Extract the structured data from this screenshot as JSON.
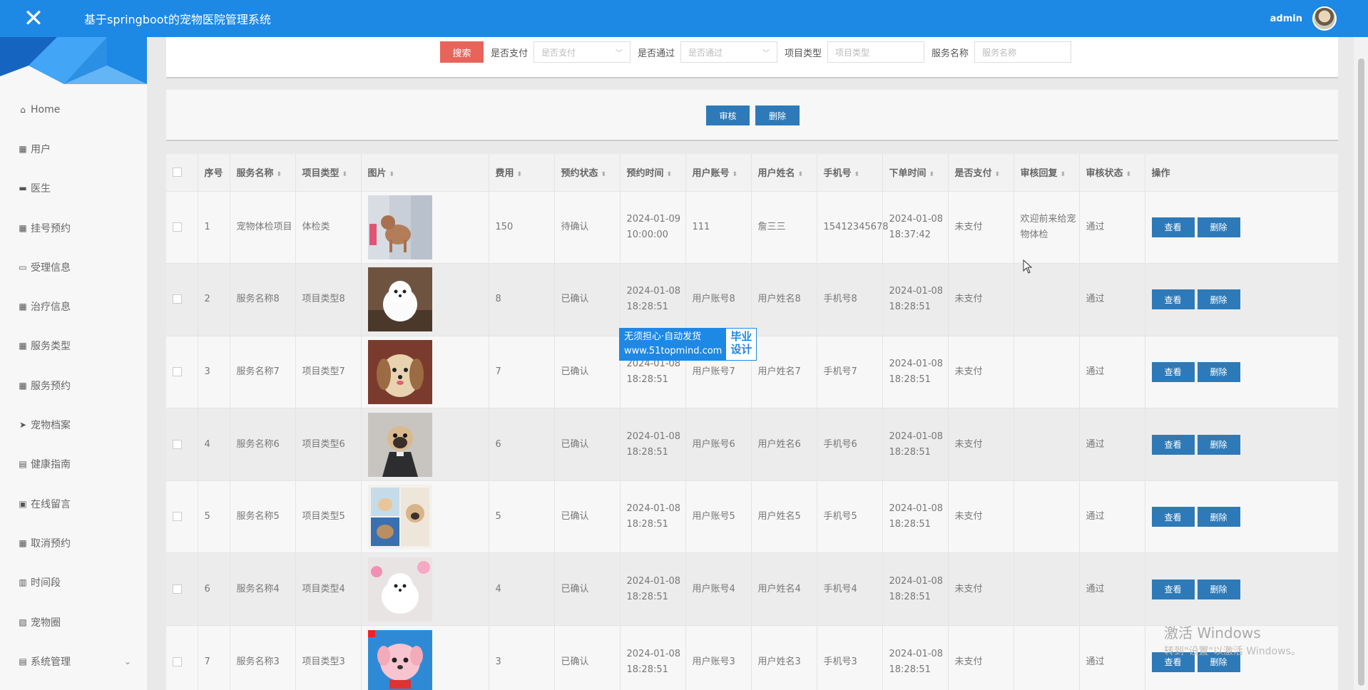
{
  "header": {
    "close_icon": "✕",
    "title": "基于springboot的宠物医院管理系统",
    "username": "admin"
  },
  "sidebar": {
    "items": [
      {
        "icon": "⌂",
        "label": "Home"
      },
      {
        "icon": "▦",
        "label": "用户"
      },
      {
        "icon": "▬",
        "label": "医生"
      },
      {
        "icon": "▦",
        "label": "挂号预约"
      },
      {
        "icon": "▭",
        "label": "受理信息"
      },
      {
        "icon": "▦",
        "label": "治疗信息"
      },
      {
        "icon": "▦",
        "label": "服务类型"
      },
      {
        "icon": "▦",
        "label": "服务预约"
      },
      {
        "icon": "➤",
        "label": "宠物档案"
      },
      {
        "icon": "▤",
        "label": "健康指南"
      },
      {
        "icon": "▣",
        "label": "在线留言"
      },
      {
        "icon": "▦",
        "label": "取消预约"
      },
      {
        "icon": "▥",
        "label": "时间段"
      },
      {
        "icon": "▧",
        "label": "宠物圈"
      },
      {
        "icon": "▤",
        "label": "系统管理",
        "arrow": "⌄"
      }
    ]
  },
  "search": {
    "button": "搜索",
    "paid_label": "是否支付",
    "paid_placeholder": "是否支付",
    "approved_label": "是否通过",
    "approved_placeholder": "是否通过",
    "type_label": "项目类型",
    "type_placeholder": "项目类型",
    "service_label": "服务名称",
    "service_placeholder": "服务名称"
  },
  "actions": {
    "audit": "审核",
    "delete": "删除"
  },
  "table": {
    "headers": [
      "序号",
      "服务名称",
      "项目类型",
      "图片",
      "费用",
      "预约状态",
      "预约时间",
      "用户账号",
      "用户姓名",
      "手机号",
      "下单时间",
      "是否支付",
      "审核回复",
      "审核状态",
      "操作"
    ],
    "sortable": [
      "服务名称",
      "项目类型",
      "图片",
      "费用",
      "预约状态",
      "预约时间",
      "用户账号",
      "用户姓名",
      "手机号",
      "下单时间",
      "是否支付",
      "审核回复",
      "审核状态"
    ],
    "view_label": "查看",
    "delete_label": "删除",
    "rows": [
      {
        "no": "1",
        "service": "宠物体检项目",
        "type": "体检类",
        "img": "poodle",
        "fee": "150",
        "status": "待确认",
        "appt_time": "2024-01-09 10:00:00",
        "account": "111",
        "name": "詹三三",
        "phone": "15412345678",
        "order_time": "2024-01-08 18:37:42",
        "paid": "未支付",
        "reply": "欢迎前来给宠物体检",
        "audit": "通过"
      },
      {
        "no": "2",
        "service": "服务名称8",
        "type": "项目类型8",
        "img": "pomeranian",
        "fee": "8",
        "status": "已确认",
        "appt_time": "2024-01-08 18:28:51",
        "account": "用户账号8",
        "name": "用户姓名8",
        "phone": "手机号8",
        "order_time": "2024-01-08 18:28:51",
        "paid": "未支付",
        "reply": "",
        "audit": "通过"
      },
      {
        "no": "3",
        "service": "服务名称7",
        "type": "项目类型7",
        "img": "shihtzu",
        "fee": "7",
        "status": "已确认",
        "appt_time": "2024-01-08 18:28:51",
        "account": "用户账号7",
        "name": "用户姓名7",
        "phone": "手机号7",
        "order_time": "2024-01-08 18:28:51",
        "paid": "未支付",
        "reply": "",
        "audit": "通过"
      },
      {
        "no": "4",
        "service": "服务名称6",
        "type": "项目类型6",
        "img": "pug",
        "fee": "6",
        "status": "已确认",
        "appt_time": "2024-01-08 18:28:51",
        "account": "用户账号6",
        "name": "用户姓名6",
        "phone": "手机号6",
        "order_time": "2024-01-08 18:28:51",
        "paid": "未支付",
        "reply": "",
        "audit": "通过"
      },
      {
        "no": "5",
        "service": "服务名称5",
        "type": "项目类型5",
        "img": "collage",
        "fee": "5",
        "status": "已确认",
        "appt_time": "2024-01-08 18:28:51",
        "account": "用户账号5",
        "name": "用户姓名5",
        "phone": "手机号5",
        "order_time": "2024-01-08 18:28:51",
        "paid": "未支付",
        "reply": "",
        "audit": "通过"
      },
      {
        "no": "6",
        "service": "服务名称4",
        "type": "项目类型4",
        "img": "whitepuppy",
        "fee": "4",
        "status": "已确认",
        "appt_time": "2024-01-08 18:28:51",
        "account": "用户账号4",
        "name": "用户姓名4",
        "phone": "手机号4",
        "order_time": "2024-01-08 18:28:51",
        "paid": "未支付",
        "reply": "",
        "audit": "通过"
      },
      {
        "no": "7",
        "service": "服务名称3",
        "type": "项目类型3",
        "img": "pinkdog",
        "fee": "3",
        "status": "已确认",
        "appt_time": "2024-01-08 18:28:51",
        "account": "用户账号3",
        "name": "用户姓名3",
        "phone": "手机号3",
        "order_time": "2024-01-08 18:28:51",
        "paid": "未支付",
        "reply": "",
        "audit": "通过"
      }
    ]
  },
  "watermark": {
    "line1": "无须担心·自动发货",
    "line2": "www.51topmind.com",
    "right1": "毕业",
    "right2": "设计"
  },
  "windows_activation": {
    "line1": "激活 Windows",
    "line2": "转到\"设置\"以激活 Windows。"
  },
  "colors": {
    "header": "#1e88e5",
    "search_button": "#e8645a",
    "action_button": "#2e7ab8"
  }
}
